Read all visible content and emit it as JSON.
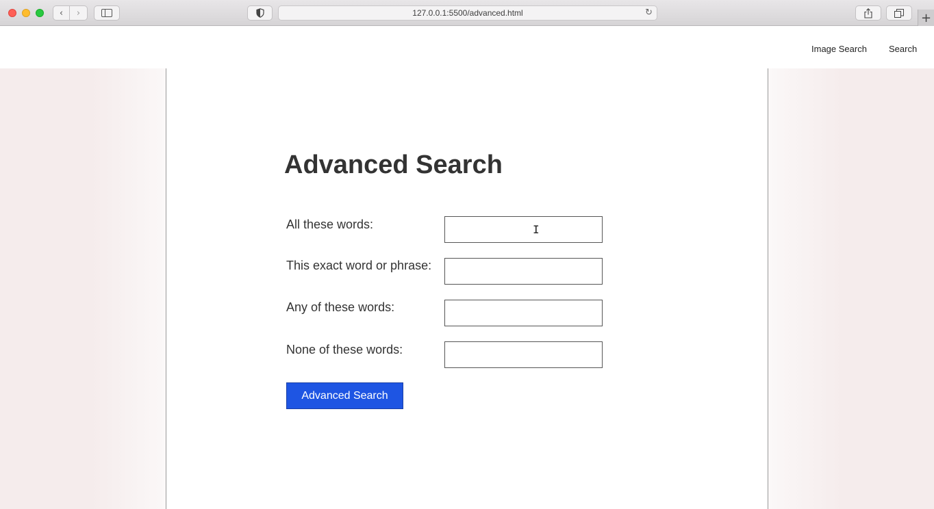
{
  "browser": {
    "url": "127.0.0.1:5500/advanced.html",
    "icons": [
      "chevron-left-icon",
      "chevron-right-icon",
      "sidebar-icon",
      "shield-icon",
      "reload-icon",
      "share-icon",
      "tabs-icon",
      "plus-icon"
    ]
  },
  "nav": {
    "image_search": "Image Search",
    "search": "Search"
  },
  "page": {
    "title": "Advanced Search",
    "fields": [
      {
        "label": "All these words:",
        "value": ""
      },
      {
        "label": "This exact word or phrase:",
        "value": ""
      },
      {
        "label": "Any of these words:",
        "value": ""
      },
      {
        "label": "None of these words:",
        "value": ""
      }
    ],
    "submit_label": "Advanced Search"
  },
  "colors": {
    "button": "#1e55e3",
    "page_side": "#f5ecec"
  }
}
